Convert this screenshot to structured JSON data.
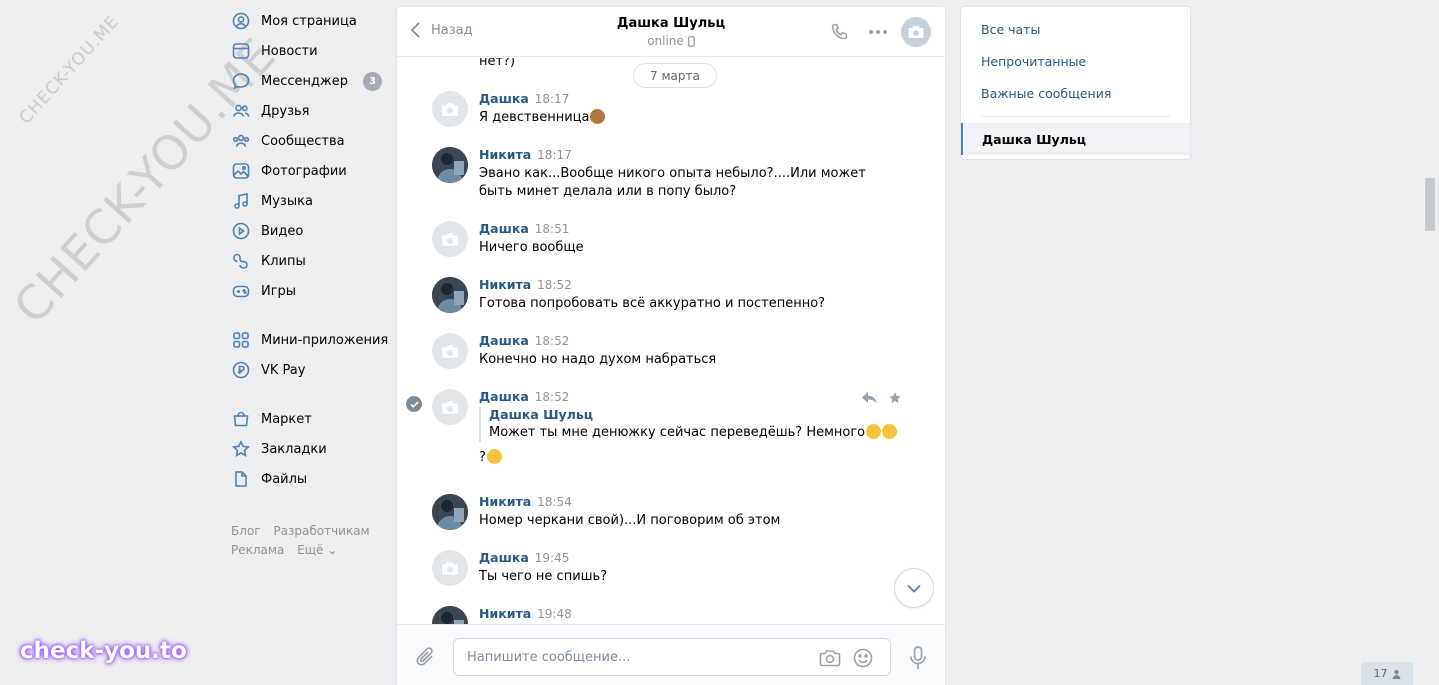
{
  "watermarks": {
    "small": "CHECK-YOU.ME",
    "big": "CHECK-YOU.ME",
    "bottom": "check-you.to"
  },
  "nav": {
    "items": [
      {
        "label": "Моя страница",
        "icon": "user-circle-icon"
      },
      {
        "label": "Новости",
        "icon": "news-icon"
      },
      {
        "label": "Мессенджер",
        "icon": "messenger-icon",
        "badge": "3"
      },
      {
        "label": "Друзья",
        "icon": "friends-icon"
      },
      {
        "label": "Сообщества",
        "icon": "communities-icon"
      },
      {
        "label": "Фотографии",
        "icon": "photos-icon"
      },
      {
        "label": "Музыка",
        "icon": "music-icon"
      },
      {
        "label": "Видео",
        "icon": "video-icon"
      },
      {
        "label": "Клипы",
        "icon": "clips-icon"
      },
      {
        "label": "Игры",
        "icon": "games-icon"
      }
    ],
    "items2": [
      {
        "label": "Мини-приложения",
        "icon": "mini-apps-icon"
      },
      {
        "label": "VK Pay",
        "icon": "vk-pay-icon"
      }
    ],
    "items3": [
      {
        "label": "Маркет",
        "icon": "market-icon"
      },
      {
        "label": "Закладки",
        "icon": "bookmarks-icon"
      },
      {
        "label": "Файлы",
        "icon": "files-icon"
      }
    ],
    "footer": {
      "blog": "Блог",
      "dev": "Разработчикам",
      "ads": "Реклама",
      "more": "Ещё"
    }
  },
  "chat": {
    "back_label": "Назад",
    "peer_name": "Дашка Шульц",
    "peer_status": "online",
    "date_label": "7 марта",
    "prev_tail": "нет?)",
    "messages": [
      {
        "author": "Дашка",
        "time": "18:17",
        "text": "Я девственница"
      },
      {
        "author": "Никита",
        "time": "18:17",
        "text": "Эвано как...Вообще никого опыта небыло?....Или может быть минет делала или в попу было?"
      },
      {
        "author": "Дашка",
        "time": "18:51",
        "text": "Ничего вообще"
      },
      {
        "author": "Никита",
        "time": "18:52",
        "text": "Готова попробовать всё аккуратно и постепенно?"
      },
      {
        "author": "Дашка",
        "time": "18:52",
        "text": "Конечно но надо духом набраться"
      },
      {
        "author": "Дашка",
        "time": "18:52",
        "forward_author": "Дашка Шульц",
        "forward_text": "Может ты мне денюжку сейчас переведёшь? Немного",
        "after_text": "?"
      },
      {
        "author": "Никита",
        "time": "18:54",
        "text": "Номер черкани свой)...И поговорим об этом"
      },
      {
        "author": "Дашка",
        "time": "19:45",
        "text": "Ты чего не спишь?"
      },
      {
        "author": "Никита",
        "time": "19:48",
        "text": ""
      }
    ],
    "composer_placeholder": "Напишите сообщение..."
  },
  "right_panel": {
    "all_chats": "Все чаты",
    "unread": "Непрочитанные",
    "important": "Важные сообщения",
    "selected": "Дашка Шульц"
  },
  "counter": "17",
  "colors": {
    "link": "#2a5885",
    "accent": "#5181b8",
    "bg": "#edeef0"
  }
}
